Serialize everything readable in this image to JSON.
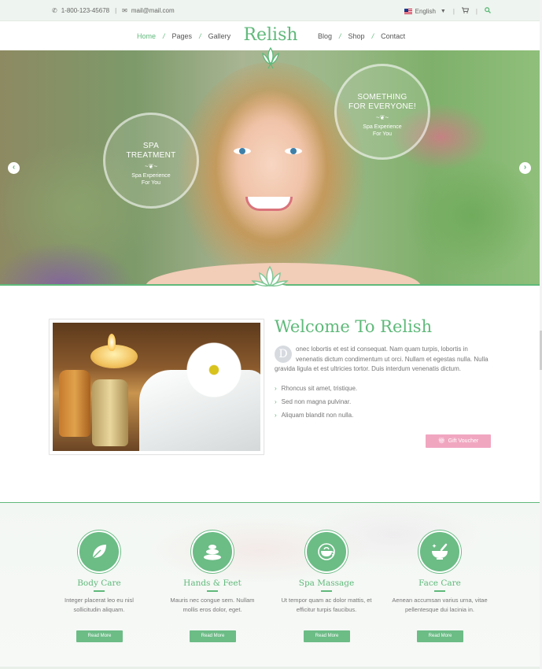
{
  "topbar": {
    "phone": "1-800-123-45678",
    "email": "mail@mail.com",
    "language": "English",
    "icons": {
      "phone": "phone-icon",
      "email": "envelope-icon",
      "flag": "uk-flag-icon",
      "caret": "caret-down-icon",
      "cart": "cart-icon",
      "search": "search-icon"
    }
  },
  "nav": {
    "left": [
      {
        "label": "Home",
        "active": true
      },
      {
        "label": "Pages",
        "active": false
      },
      {
        "label": "Gallery",
        "active": false
      }
    ],
    "right": [
      {
        "label": "Blog",
        "active": false
      },
      {
        "label": "Shop",
        "active": false
      },
      {
        "label": "Contact",
        "active": false
      }
    ],
    "separator": "/",
    "logo": "Relish"
  },
  "hero": {
    "badge_left": {
      "title_line1": "SPA",
      "title_line2": "TREATMENT",
      "ornament": "~❦~",
      "sub_line1": "Spa Experience",
      "sub_line2": "For You"
    },
    "badge_right": {
      "title_line1": "SOMETHING",
      "title_line2": "FOR EVERYONE!",
      "ornament": "~❦~",
      "sub_line1": "Spa Experience",
      "sub_line2": "For You"
    },
    "prev_arrow": "‹",
    "next_arrow": "›"
  },
  "welcome": {
    "title": "Welcome To Relish",
    "dropcap": "D",
    "paragraph": "onec lobortis et est id consequat. Nam quam turpis, lobortis in venenatis dictum condimentum ut orci. Nullam et egestas nulla. Nulla gravida ligula et est ultricies tortor. Duis interdum venenatis dictum.",
    "bullets": [
      "Rhoncus sit amet, tristique.",
      "Sed non magna pulvinar.",
      "Aliquam blandit non nulla."
    ],
    "gift_button": "Gift Voucher"
  },
  "services": [
    {
      "name": "Body Care",
      "desc_line1": "Integer placerat leo eu nisl",
      "desc_line2": "sollicitudin aliquam.",
      "button": "Read More",
      "icon": "leaf-icon"
    },
    {
      "name": "Hands & Feet",
      "desc_line1": "Mauris nec congue sem. Nullam",
      "desc_line2": "mollis eros dolor, eget.",
      "button": "Read More",
      "icon": "stones-icon"
    },
    {
      "name": "Spa Massage",
      "desc_line1": "Ut tempor quam ac dolor mattis, et",
      "desc_line2": "efficitur turpis faucibus.",
      "button": "Read More",
      "icon": "teapot-icon"
    },
    {
      "name": "Face Care",
      "desc_line1": "Aenean accumsan varius urna, vitae",
      "desc_line2": "pellentesque dui lacinia in.",
      "button": "Read More",
      "icon": "mortar-pestle-icon"
    }
  ],
  "colors": {
    "accent": "#5fb97a",
    "gift": "#f1a6c0",
    "topbar_bg": "#eef4ef"
  }
}
